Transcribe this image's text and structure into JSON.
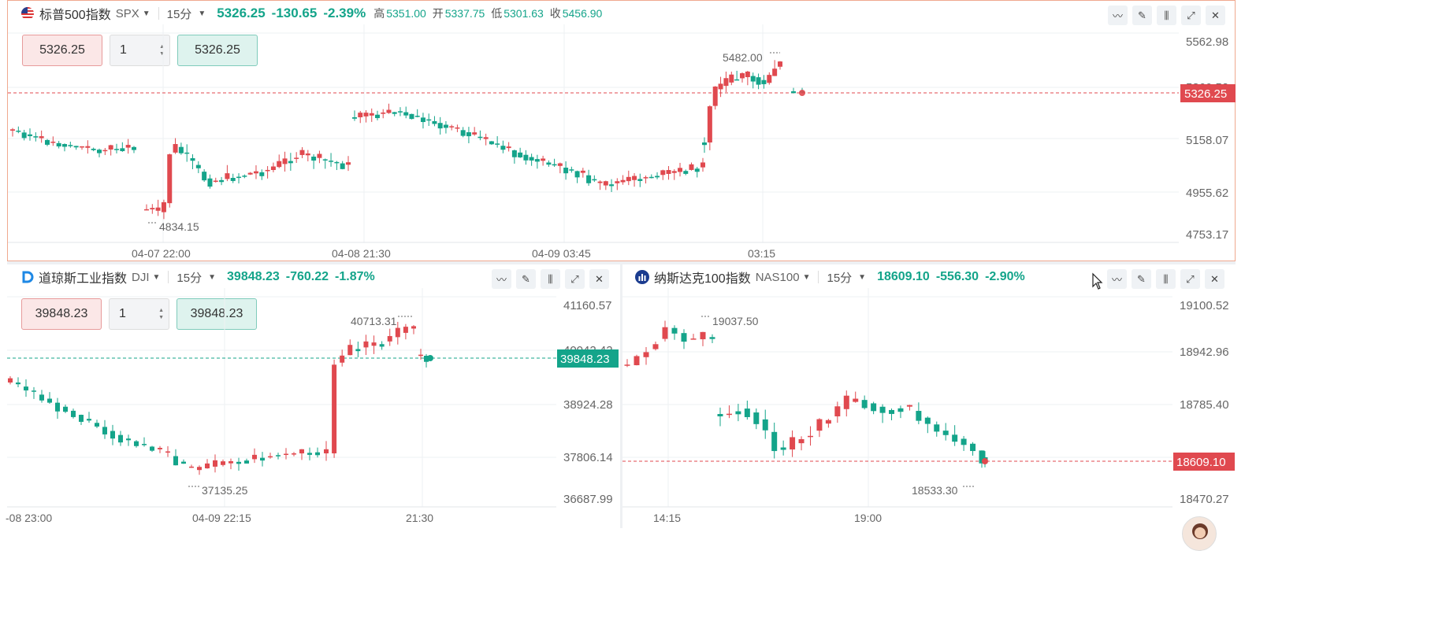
{
  "colors": {
    "up": "#14a48a",
    "down": "#e0494f",
    "grid": "#eef0f3",
    "border_active": "#f0a98f"
  },
  "panels": {
    "spx": {
      "name": "标普500指数",
      "symbol": "SPX",
      "timeframe": "15分",
      "price": "5326.25",
      "change": "-130.65",
      "change_pct": "-2.39%",
      "ohlc": [
        {
          "label": "高",
          "value": "5351.00"
        },
        {
          "label": "开",
          "value": "5337.75"
        },
        {
          "label": "低",
          "value": "5301.63"
        },
        {
          "label": "收",
          "value": "5456.90"
        }
      ],
      "order": {
        "sell": "5326.25",
        "qty": "1",
        "buy": "5326.25"
      },
      "y_ticks": [
        "5562.98",
        "5360.52",
        "5158.07",
        "4955.62",
        "4753.17"
      ],
      "price_tag": "5326.25",
      "x_ticks": [
        "04-07 22:00",
        "04-08 21:30",
        "04-09 03:45",
        "03:15"
      ],
      "high_label": "5482.00",
      "low_label": "4834.15"
    },
    "dji": {
      "name": "道琼斯工业指数",
      "symbol": "DJI",
      "timeframe": "15分",
      "price": "39848.23",
      "change": "-760.22",
      "change_pct": "-1.87%",
      "order": {
        "sell": "39848.23",
        "qty": "1",
        "buy": "39848.23"
      },
      "y_ticks": [
        "41160.57",
        "40042.42",
        "38924.28",
        "37806.14",
        "36687.99"
      ],
      "price_tag": "39848.23",
      "x_ticks": [
        "-08 23:00",
        "04-09 22:15",
        "21:30"
      ],
      "high_label": "40713.31",
      "low_label": "37135.25"
    },
    "nas": {
      "name": "纳斯达克100指数",
      "symbol": "NAS100",
      "timeframe": "15分",
      "price": "18609.10",
      "change": "-556.30",
      "change_pct": "-2.90%",
      "y_ticks": [
        "19100.52",
        "18942.96",
        "18785.40",
        "18470.27"
      ],
      "price_tag": "18609.10",
      "x_ticks": [
        "14:15",
        "19:00"
      ],
      "high_label": "19037.50",
      "low_label": "18533.30"
    }
  },
  "icons": [
    "indicator-icon",
    "draw-icon",
    "candle-icon",
    "expand-icon",
    "close-icon"
  ]
}
